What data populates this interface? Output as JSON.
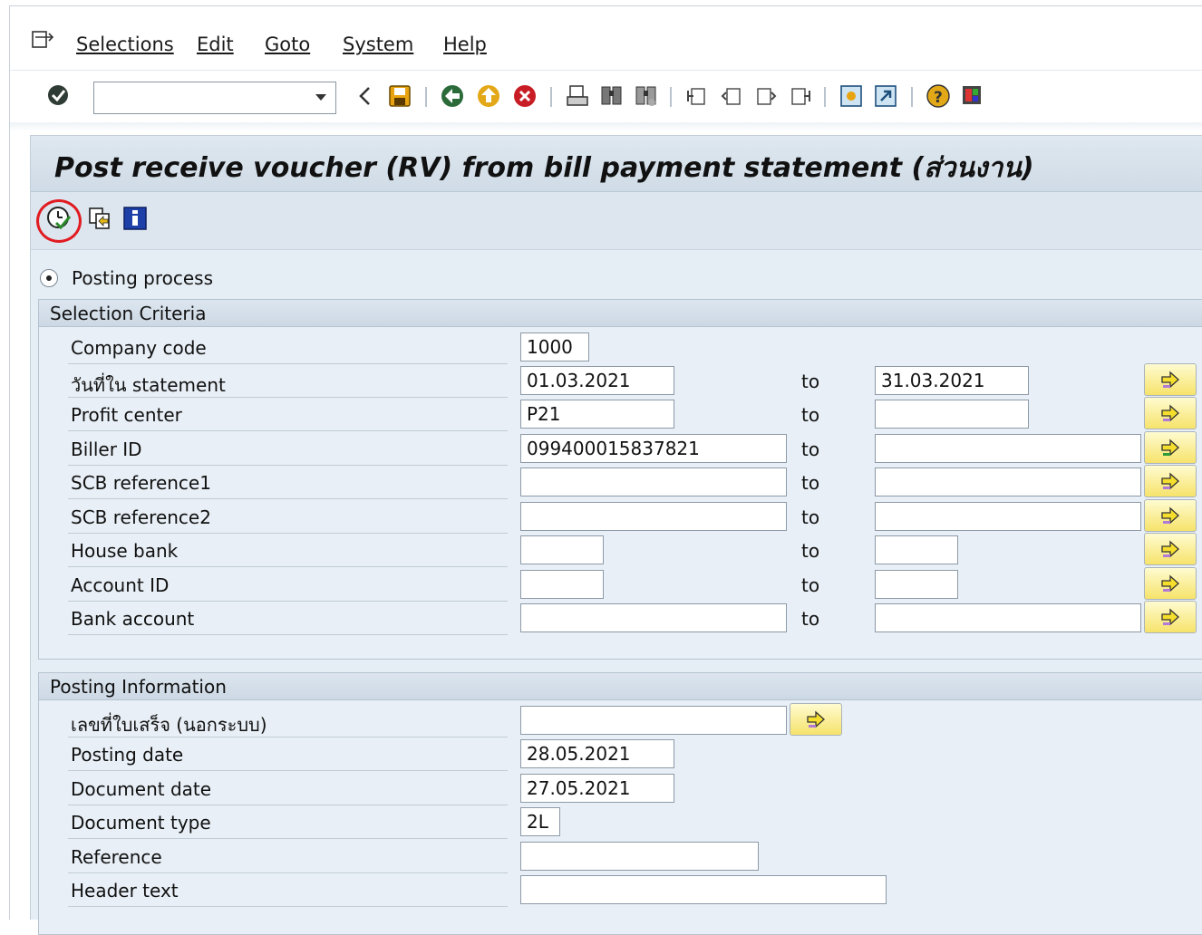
{
  "menu": {
    "items": [
      {
        "label": "Selections"
      },
      {
        "label": "Edit"
      },
      {
        "label": "Goto"
      },
      {
        "label": "System"
      },
      {
        "label": "Help"
      }
    ]
  },
  "toolbar": {
    "command_field_value": "",
    "icons": [
      "enter-icon",
      "back-icon",
      "save-icon",
      "back-green-icon",
      "exit-icon",
      "cancel-icon",
      "print-icon",
      "find-icon",
      "find-next-icon",
      "first-page-icon",
      "previous-page-icon",
      "next-page-icon",
      "last-page-icon",
      "create-session-icon",
      "shortcut-icon",
      "help-icon",
      "customize-layout-icon"
    ]
  },
  "page": {
    "title": "Post receive voucher (RV) from bill payment statement (ส่วนงาน)",
    "app_toolbar_icons": [
      "execute-icon",
      "variant-icon",
      "information-icon"
    ]
  },
  "mode": {
    "label": "Posting process",
    "selected": true
  },
  "selection_criteria": {
    "title": "Selection Criteria",
    "to_label": "to",
    "rows": [
      {
        "label": "Company code",
        "from": "1000",
        "to": null
      },
      {
        "label": "วันที่ใน statement",
        "from": "01.03.2021",
        "to": "31.03.2021"
      },
      {
        "label": "Profit center",
        "from": "P21",
        "to": ""
      },
      {
        "label": "Biller ID",
        "from": "099400015837821",
        "to": ""
      },
      {
        "label": "SCB reference1",
        "from": "",
        "to": ""
      },
      {
        "label": "SCB reference2",
        "from": "",
        "to": ""
      },
      {
        "label": "House bank",
        "from": "",
        "to": ""
      },
      {
        "label": "Account ID",
        "from": "",
        "to": ""
      },
      {
        "label": "Bank account",
        "from": "",
        "to": ""
      }
    ]
  },
  "posting_information": {
    "title": "Posting Information",
    "rows": [
      {
        "label": "เลขที่ใบเสร็จ (นอกระบบ)",
        "value": ""
      },
      {
        "label": "Posting date",
        "value": "28.05.2021"
      },
      {
        "label": "Document date",
        "value": "27.05.2021"
      },
      {
        "label": "Document type",
        "value": "2L"
      },
      {
        "label": "Reference",
        "value": ""
      },
      {
        "label": "Header text",
        "value": ""
      }
    ]
  },
  "colors": {
    "highlight_circle": "#e11b22",
    "panel_bg": "#e6eef5",
    "multi_button": "#f6e36b"
  }
}
